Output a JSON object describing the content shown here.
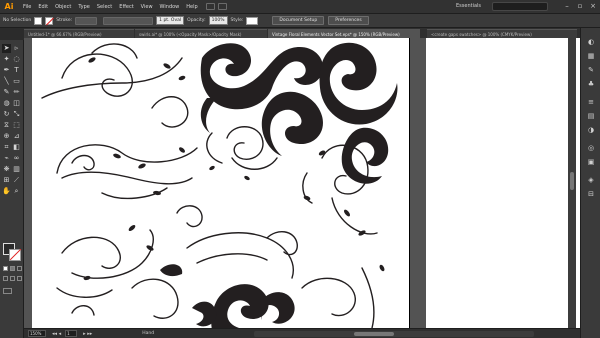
{
  "app": {
    "logo": "Ai",
    "menu": [
      "File",
      "Edit",
      "Object",
      "Type",
      "Select",
      "Effect",
      "View",
      "Window",
      "Help"
    ],
    "workspace": "Essentials",
    "window_controls": [
      "minimize",
      "restore",
      "close"
    ]
  },
  "control": {
    "selection_label": "No Selection",
    "stroke_label": "Stroke:",
    "stroke_weight": "",
    "brush_label": "1 pt. Oval",
    "opacity_label": "Opacity:",
    "opacity_value": "100%",
    "style_label": "Style:",
    "doc_setup_button": "Document Setup",
    "preferences_button": "Preferences"
  },
  "tabs": [
    {
      "label": "Untitled-1* @ 66.67% (RGB/Preview)",
      "active": false
    },
    {
      "label": "swirls.ai* @ 100% (<Opacity Mask>/Opacity Mask)",
      "active": false
    },
    {
      "label": "Vintage Floral Elements Vector Set.eps* @ 150% (RGB/Preview)",
      "active": true
    },
    {
      "label": "<create gaps swatches> @ 100% (CMYK/Preview)",
      "active": false
    }
  ],
  "status": {
    "zoom": "150%",
    "page": "1",
    "mode": "Hand"
  },
  "colors": {
    "app_bg": "#2b2b2b",
    "panel_bg": "#3a3a3a",
    "canvas_bg": "#535353",
    "artboard": "#ffffff",
    "ink": "#231f20",
    "accent_logo": "#ff9a00"
  },
  "icons": {
    "tools": [
      "selection-icon",
      "direct-selection-icon",
      "magic-wand-icon",
      "lasso-icon",
      "pen-icon",
      "type-icon",
      "line-icon",
      "rectangle-icon",
      "paintbrush-icon",
      "pencil-icon",
      "blob-brush-icon",
      "eraser-icon",
      "rotate-icon",
      "scale-icon",
      "width-icon",
      "free-transform-icon",
      "shape-builder-icon",
      "perspective-icon",
      "mesh-icon",
      "gradient-icon",
      "eyedropper-icon",
      "blend-icon",
      "symbol-sprayer-icon",
      "graph-icon",
      "artboard-icon",
      "slice-icon",
      "hand-icon",
      "zoom-icon"
    ],
    "dock": [
      "color-panel-icon",
      "swatches-icon",
      "brushes-icon",
      "symbols-icon",
      "stroke-icon",
      "gradient-panel-icon",
      "transparency-icon",
      "appearance-icon",
      "graphic-styles-icon",
      "layers-icon",
      "artboards-icon"
    ]
  }
}
